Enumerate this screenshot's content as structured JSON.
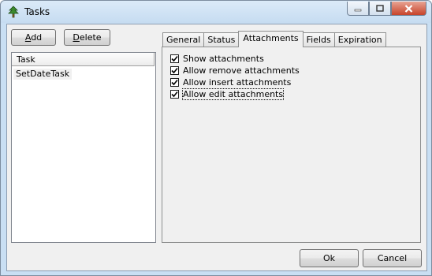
{
  "window": {
    "title": "Tasks",
    "icon": "tree-icon"
  },
  "titlebar_buttons": [
    "minimize-icon",
    "maximize-icon",
    "close-icon"
  ],
  "toolbar": {
    "add_label": "Add",
    "add_mnemonic": "A",
    "delete_label": "Delete",
    "delete_mnemonic": "D"
  },
  "task_list": {
    "column_header": "Task",
    "items": [
      "SetDateTask"
    ]
  },
  "tabs": [
    {
      "label": "General",
      "active": false
    },
    {
      "label": "Status",
      "active": false
    },
    {
      "label": "Attachments",
      "active": true
    },
    {
      "label": "Fields",
      "active": false
    },
    {
      "label": "Expiration",
      "active": false
    }
  ],
  "attachments": {
    "options": [
      {
        "label": "Show attachments",
        "checked": true
      },
      {
        "label": "Allow remove attachments",
        "checked": true
      },
      {
        "label": "Allow insert attachments",
        "checked": true
      },
      {
        "label": "Allow edit attachments",
        "checked": true
      }
    ]
  },
  "footer": {
    "ok_label": "Ok",
    "cancel_label": "Cancel"
  },
  "colors": {
    "frame": "#c9dff3",
    "client": "#f0f0f0",
    "close_button": "#c7432a"
  }
}
